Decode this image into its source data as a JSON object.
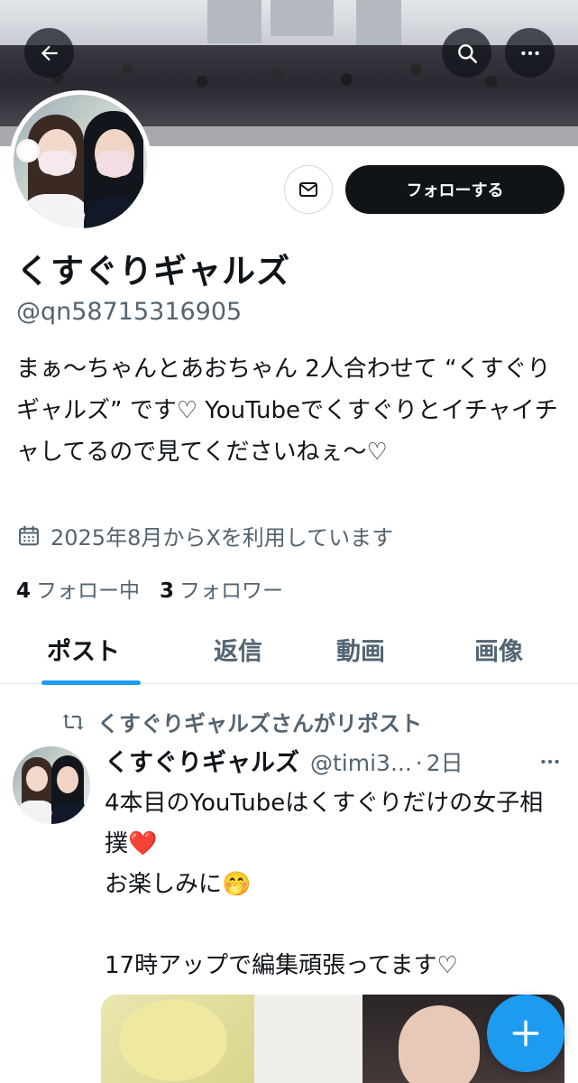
{
  "profile": {
    "display_name": "くすぐりギャルズ",
    "handle": "@qn58715316905",
    "bio": "まぁ〜ちゃんとあおちゃん 2人合わせて “くすぐりギャルズ” です♡ YouTubeでくすぐりとイチャイチャしてるので見てくださいねぇ〜♡",
    "joined": "2025年8月からXを利用しています",
    "following_count": "4",
    "following_label": "フォロー中",
    "followers_count": "3",
    "followers_label": "フォロワー"
  },
  "actions": {
    "follow_label": "フォローする"
  },
  "tabs": [
    {
      "label": "ポスト",
      "active": true
    },
    {
      "label": "返信",
      "active": false
    },
    {
      "label": "動画",
      "active": false
    },
    {
      "label": "画像",
      "active": false
    }
  ],
  "post": {
    "repost_label": "くすぐりギャルズさんがリポスト",
    "author_name": "くすぐりギャルズ",
    "author_handle": "@timi3...",
    "separator": "·",
    "time": "2日",
    "text": "4本目のYouTubeはくすぐりだけの女子相撲❤️\nお楽しみに🤭\n\n17時アップで編集頑張ってます♡"
  },
  "icons": {
    "back": "arrow-left-icon",
    "search": "search-icon",
    "more": "more-horizontal-icon",
    "message": "mail-icon",
    "calendar": "calendar-icon",
    "repost": "repost-icon",
    "compose": "plus-icon"
  },
  "colors": {
    "accent": "#1d9bf0",
    "text_primary": "#0f1419",
    "text_secondary": "#536471",
    "follow_button_bg": "#0f1419"
  }
}
